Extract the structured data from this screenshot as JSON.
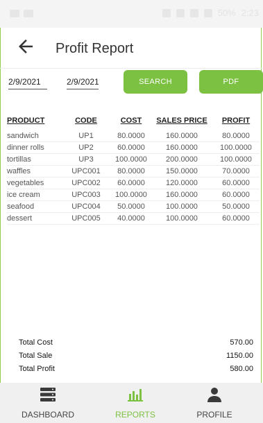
{
  "status_bar": {
    "battery": "50%",
    "time": "2:23"
  },
  "app_bar": {
    "title": "Profit Report"
  },
  "filters": {
    "from_date": "2/9/2021",
    "to_date": "2/9/2021",
    "search_label": "SEARCH",
    "pdf_label": "PDF"
  },
  "table": {
    "headers": [
      "PRODUCT",
      "CODE",
      "COST",
      "SALES PRICE",
      "PROFIT"
    ],
    "rows": [
      [
        "sandwich",
        "UP1",
        "80.0000",
        "160.0000",
        "80.0000"
      ],
      [
        "dinner rolls",
        "UP2",
        "60.0000",
        "160.0000",
        "100.0000"
      ],
      [
        "tortillas",
        "UP3",
        "100.0000",
        "200.0000",
        "100.0000"
      ],
      [
        "waffles",
        "UPC001",
        "80.0000",
        "150.0000",
        "70.0000"
      ],
      [
        "vegetables",
        "UPC002",
        "60.0000",
        "120.0000",
        "60.0000"
      ],
      [
        "ice cream",
        "UPC003",
        "100.0000",
        "160.0000",
        "60.0000"
      ],
      [
        "seafood",
        "UPC004",
        "50.0000",
        "100.0000",
        "50.0000"
      ],
      [
        "dessert",
        "UPC005",
        "40.0000",
        "100.0000",
        "60.0000"
      ]
    ]
  },
  "totals": [
    {
      "label": "Total Cost",
      "value": "570.00"
    },
    {
      "label": "Total Sale",
      "value": "1150.00"
    },
    {
      "label": "Total Profit",
      "value": "580.00"
    }
  ],
  "nav": [
    {
      "label": "DASHBOARD",
      "icon": "server-icon"
    },
    {
      "label": "REPORTS",
      "icon": "bar-chart-icon"
    },
    {
      "label": "PROFILE",
      "icon": "person-icon"
    }
  ],
  "colors": {
    "accent": "#7cc142",
    "text": "#333333"
  }
}
